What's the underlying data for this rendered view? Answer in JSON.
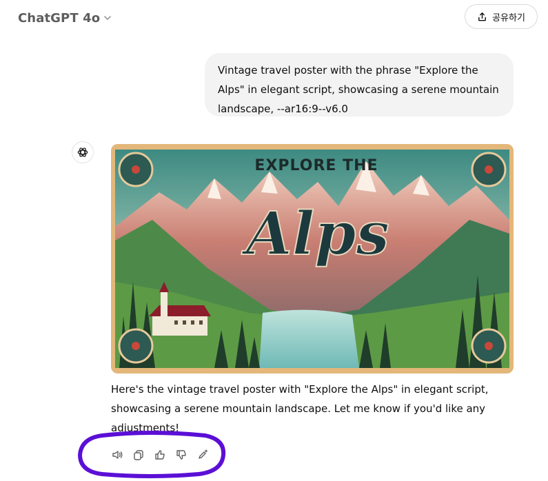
{
  "header": {
    "model_label": "ChatGPT 4o",
    "share_label": "공유하기"
  },
  "conversation": {
    "user_message": "Vintage travel poster with the phrase \"Explore the Alps\" in elegant script, showcasing a serene mountain landscape, --ar16:9--v6.0",
    "assistant": {
      "poster": {
        "heading_text": "EXPLORE THE",
        "script_text": "Alps"
      },
      "reply_text": "Here's the vintage travel poster with \"Explore the Alps\" in elegant script, showcasing a serene mountain landscape. Let me know if you'd like any adjustments!",
      "actions": [
        {
          "name": "read-aloud",
          "icon": "speaker-icon"
        },
        {
          "name": "copy",
          "icon": "copy-icon"
        },
        {
          "name": "good-response",
          "icon": "thumbs-up-icon"
        },
        {
          "name": "bad-response",
          "icon": "thumbs-down-icon"
        },
        {
          "name": "edit-image",
          "icon": "pencil-sparkle-icon"
        }
      ]
    }
  },
  "colors": {
    "annotation": "#5b0fd6",
    "bubble": "#f3f3f3",
    "poster_border": "#e3b77a"
  }
}
